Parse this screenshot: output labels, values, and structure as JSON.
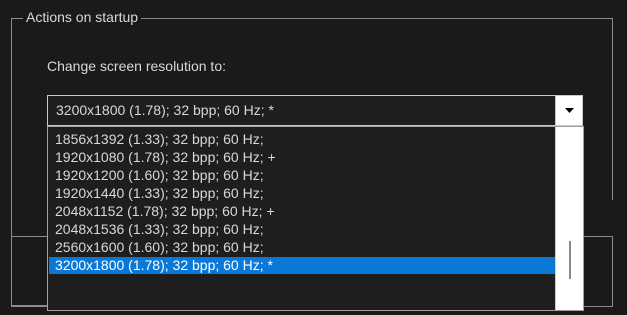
{
  "group": {
    "title": "Actions on startup"
  },
  "prompt": "Change screen resolution to:",
  "combo": {
    "selected": "3200x1800 (1.78); 32 bpp; 60 Hz; *"
  },
  "dropdown": {
    "items": [
      "1856x1392 (1.33); 32 bpp; 60 Hz;",
      "1920x1080 (1.78); 32 bpp; 60 Hz; +",
      "1920x1200 (1.60); 32 bpp; 60 Hz;",
      "1920x1440 (1.33); 32 bpp; 60 Hz;",
      "2048x1152 (1.78); 32 bpp; 60 Hz; +",
      "2048x1536 (1.33); 32 bpp; 60 Hz;",
      "2560x1600 (1.60); 32 bpp; 60 Hz;",
      "3200x1800 (1.78); 32 bpp; 60 Hz; *"
    ],
    "selected_index": 7
  },
  "colors": {
    "selection": "#0a78d7",
    "background": "#1a1a1a"
  },
  "icons": {
    "dropdown_arrow": "chevron-down-icon"
  }
}
